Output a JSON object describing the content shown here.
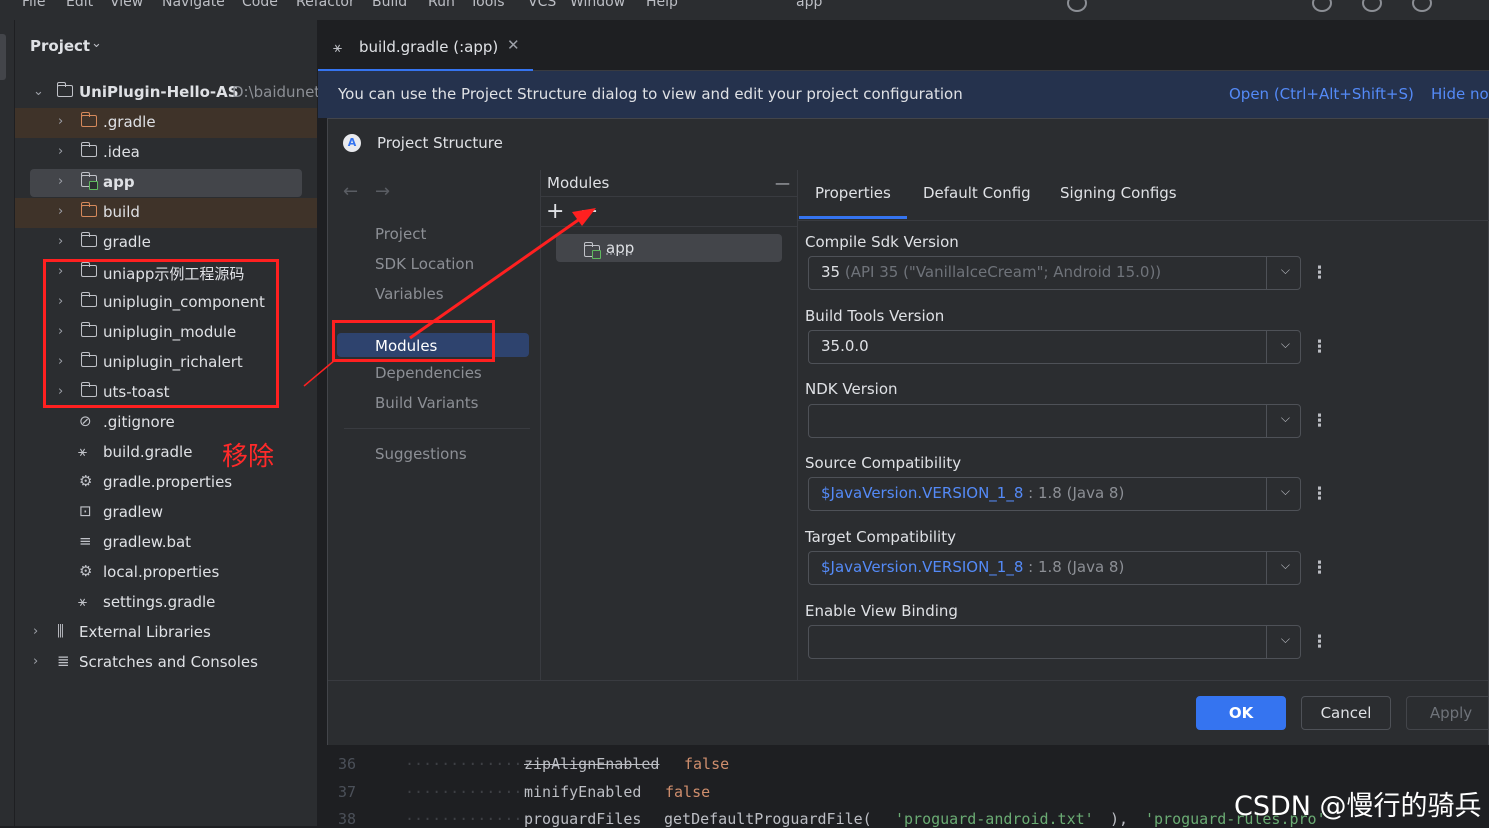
{
  "menu": {
    "items": [
      "File",
      "Edit",
      "View",
      "Navigate",
      "Code",
      "Refactor",
      "Build",
      "Run",
      "Tools",
      "VCS",
      "Window",
      "Help"
    ],
    "run_config": "app"
  },
  "project_panel": {
    "header": "Project",
    "root_name": "UniPlugin-Hello-AS",
    "root_path": "D:\\baidunet",
    "tree": [
      {
        "label": ".gradle",
        "kind": "folder-excluded"
      },
      {
        "label": ".idea",
        "kind": "folder"
      },
      {
        "label": "app",
        "kind": "module"
      },
      {
        "label": "build",
        "kind": "folder-excluded"
      },
      {
        "label": "gradle",
        "kind": "folder"
      },
      {
        "label": "uniapp示例工程源码",
        "kind": "folder"
      },
      {
        "label": "uniplugin_component",
        "kind": "folder"
      },
      {
        "label": "uniplugin_module",
        "kind": "folder"
      },
      {
        "label": "uniplugin_richalert",
        "kind": "folder"
      },
      {
        "label": "uts-toast",
        "kind": "folder"
      },
      {
        "label": ".gitignore",
        "kind": "gitignore-file"
      },
      {
        "label": "build.gradle",
        "kind": "gradle-file"
      },
      {
        "label": "gradle.properties",
        "kind": "settings-file"
      },
      {
        "label": "gradlew",
        "kind": "shell-file"
      },
      {
        "label": "gradlew.bat",
        "kind": "text-file"
      },
      {
        "label": "local.properties",
        "kind": "settings-file"
      },
      {
        "label": "settings.gradle",
        "kind": "gradle-file"
      },
      {
        "label": "External Libraries",
        "kind": "libraries"
      },
      {
        "label": "Scratches and Consoles",
        "kind": "scratches"
      }
    ],
    "annotation": "移除"
  },
  "editor": {
    "tab_label": "build.gradle (:app)",
    "notification": {
      "text": "You can use the Project Structure dialog to view and edit your project configuration",
      "open_link": "Open (Ctrl+Alt+Shift+S)",
      "hide_link": "Hide no"
    },
    "code_lines": [
      {
        "num": "36",
        "key": "zipAlignEnabled",
        "value": "false"
      },
      {
        "num": "37",
        "key": "minifyEnabled",
        "value": "false"
      },
      {
        "num": "38",
        "key": "proguardFiles",
        "call": "getDefaultProguardFile(",
        "arg1": "'proguard-android.txt'",
        "sep": "), ",
        "arg2": "'proguard-rules.pro'"
      }
    ]
  },
  "dialog": {
    "title": "Project Structure",
    "nav": {
      "items": [
        "Project",
        "SDK Location",
        "Variables",
        "Modules",
        "Dependencies",
        "Build Variants",
        "Suggestions"
      ],
      "selected": "Modules"
    },
    "modules": {
      "header": "Modules",
      "items": [
        "app"
      ]
    },
    "tabs": [
      "Properties",
      "Default Config",
      "Signing Configs"
    ],
    "fields": [
      {
        "label": "Compile Sdk Version",
        "value": "35",
        "hint": "(API 35 (\"VanillaIceCream\"; Android 15.0))"
      },
      {
        "label": "Build Tools Version",
        "value": "35.0.0",
        "hint": ""
      },
      {
        "label": "NDK Version",
        "value": "",
        "hint": ""
      },
      {
        "label": "Source Compatibility",
        "value": "$JavaVersion.VERSION_1_8",
        "hint": ": 1.8 (Java 8)"
      },
      {
        "label": "Target Compatibility",
        "value": "$JavaVersion.VERSION_1_8",
        "hint": ": 1.8 (Java 8)"
      },
      {
        "label": "Enable View Binding",
        "value": "",
        "hint": ""
      }
    ],
    "buttons": {
      "ok": "OK",
      "cancel": "Cancel",
      "apply": "Apply"
    }
  },
  "watermark": "CSDN @慢行的骑兵",
  "colors": {
    "accent": "#3574f0",
    "annotation_red": "#ff2020",
    "link": "#548af7",
    "keyword": "#cf8e6d",
    "string": "#6aab73"
  }
}
